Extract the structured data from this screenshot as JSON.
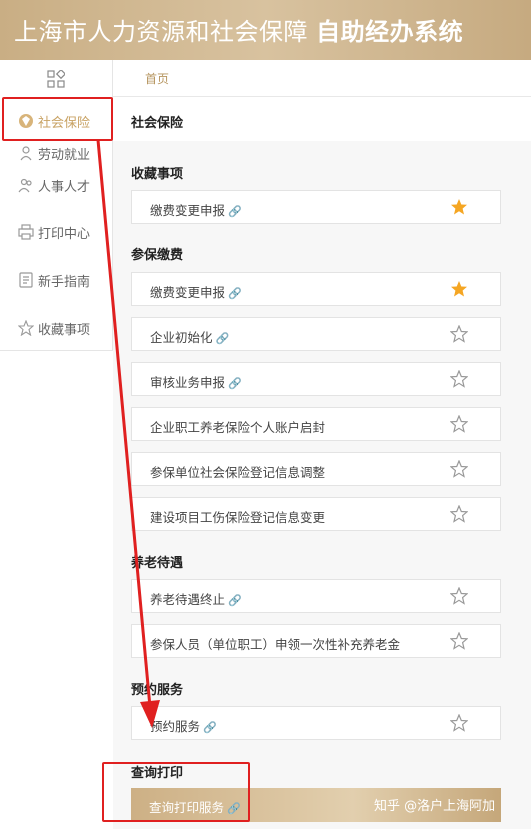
{
  "header": {
    "title_normal": "上海市人力资源和社会保障",
    "title_bold": "自助经办系统"
  },
  "sidebar": {
    "items": [
      {
        "label": "社会保险",
        "icon": "shield-icon",
        "active": true
      },
      {
        "label": "劳动就业",
        "icon": "worker-icon"
      },
      {
        "label": "人事人才",
        "icon": "people-icon"
      },
      {
        "label": "打印中心",
        "icon": "printer-icon"
      },
      {
        "label": "新手指南",
        "icon": "guide-icon"
      },
      {
        "label": "收藏事项",
        "icon": "star-icon"
      }
    ]
  },
  "breadcrumb": {
    "home": "首页"
  },
  "page_title": "社会保险",
  "sections": {
    "favorites": {
      "title": "收藏事项",
      "items": [
        {
          "label": "缴费变更申报",
          "link": true,
          "starred": true
        }
      ]
    },
    "insurance": {
      "title": "参保缴费",
      "items": [
        {
          "label": "缴费变更申报",
          "link": true,
          "starred": true
        },
        {
          "label": "企业初始化",
          "link": true,
          "starred": false
        },
        {
          "label": "审核业务申报",
          "link": true,
          "starred": false
        },
        {
          "label": "企业职工养老保险个人账户启封",
          "link": false,
          "starred": false
        },
        {
          "label": "参保单位社会保险登记信息调整",
          "link": false,
          "starred": false
        },
        {
          "label": "建设项目工伤保险登记信息变更",
          "link": false,
          "starred": false
        }
      ]
    },
    "pension": {
      "title": "养老待遇",
      "items": [
        {
          "label": "养老待遇终止",
          "link": true,
          "starred": false
        },
        {
          "label": "参保人员（单位职工）申领一次性补充养老金",
          "link": false,
          "starred": false
        }
      ]
    },
    "appointment": {
      "title": "预约服务",
      "items": [
        {
          "label": "预约服务",
          "link": true,
          "starred": false
        }
      ]
    },
    "print": {
      "title": "查询打印",
      "items": [
        {
          "label": "查询打印服务",
          "link": true,
          "starred": false
        }
      ]
    }
  },
  "watermark": "知乎 @洛户上海阿加",
  "colors": {
    "gold": "#c8a263",
    "star_filled": "#f5a623",
    "annotation": "#e02020"
  }
}
